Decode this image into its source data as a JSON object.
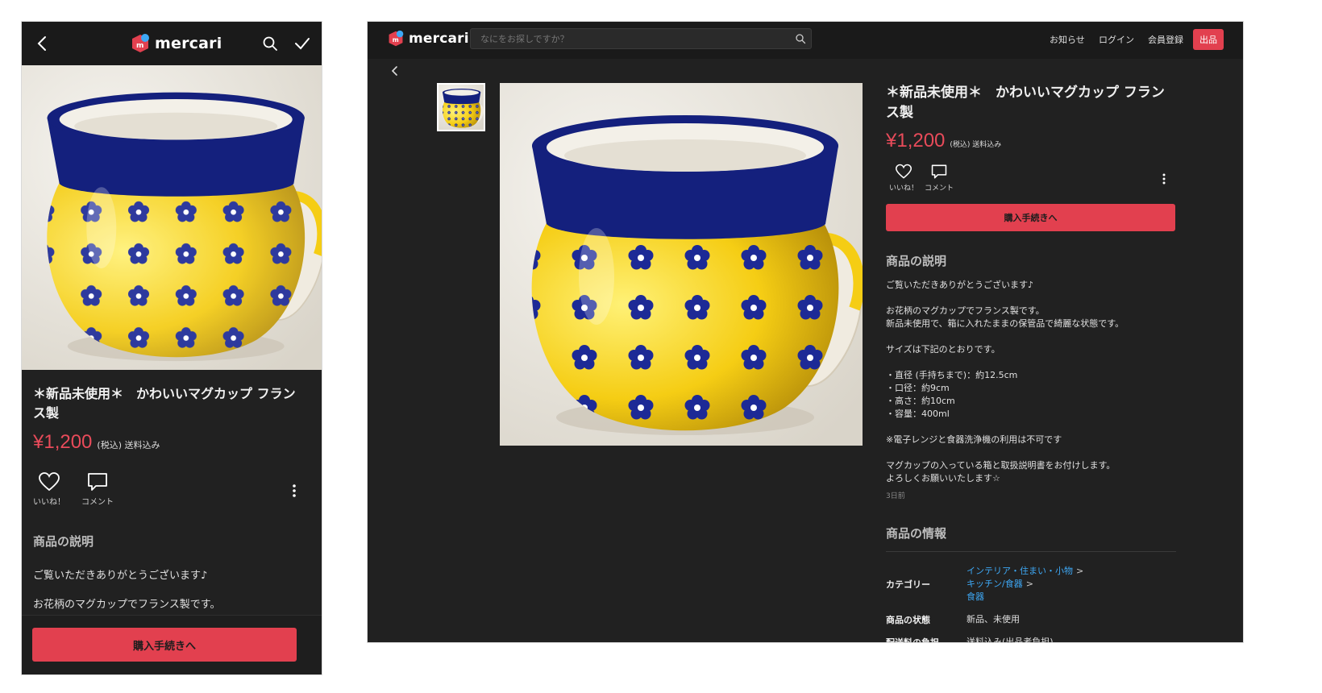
{
  "brand": {
    "name": "mercari",
    "accent": "#e2404f",
    "price_color": "#e84b5a",
    "link_color": "#3ea8f5"
  },
  "header": {
    "search_placeholder": "なにをお探しですか？",
    "nav": {
      "notice": "お知らせ",
      "login": "ログイン",
      "signup": "会員登録",
      "sell": "出品"
    }
  },
  "icons": {
    "back": "chevron-left-icon",
    "search": "search-icon",
    "check": "check-icon",
    "like": "heart-icon",
    "comment": "comment-icon",
    "more": "more-vertical-icon"
  },
  "item": {
    "title": "＊新品未使用＊　かわいいマグカップ フランス製",
    "price": "¥1,200",
    "price_note": "(税込) 送料込み",
    "like_label": "いいね！",
    "comment_label": "コメント",
    "buy_label": "購入手続きへ",
    "description_title": "商品の説明",
    "description_lines": [
      "ご覧いただきありがとうございます♪",
      "",
      "お花柄のマグカップでフランス製です。",
      "新品未使用で、箱に入れたままの保管品で綺麗な状態です。",
      "",
      "サイズは下記のとおりです。",
      "",
      "・直径 (手持ちまで)：約12.5cm",
      "・口径：約9cm",
      "・高さ：約10cm",
      "・容量：400ml",
      "",
      "※電子レンジと食器洗浄機の利用は不可です",
      "",
      "マグカップの入っている箱と取扱説明書をお付けします。",
      "よろしくお願いいたします☆"
    ],
    "mobile_description": [
      "ご覧いただきありがとうございます♪",
      "お花柄のマグカップでフランス製です。"
    ],
    "posted": "3日前",
    "info_title": "商品の情報",
    "info": {
      "category_label": "カテゴリー",
      "categories": [
        "インテリア・住まい・小物",
        "キッチン/食器",
        "食器"
      ],
      "condition_label": "商品の状態",
      "condition": "新品、未使用",
      "shipping_label": "配送料の負担",
      "shipping": "送料込み(出品者負担)"
    }
  }
}
